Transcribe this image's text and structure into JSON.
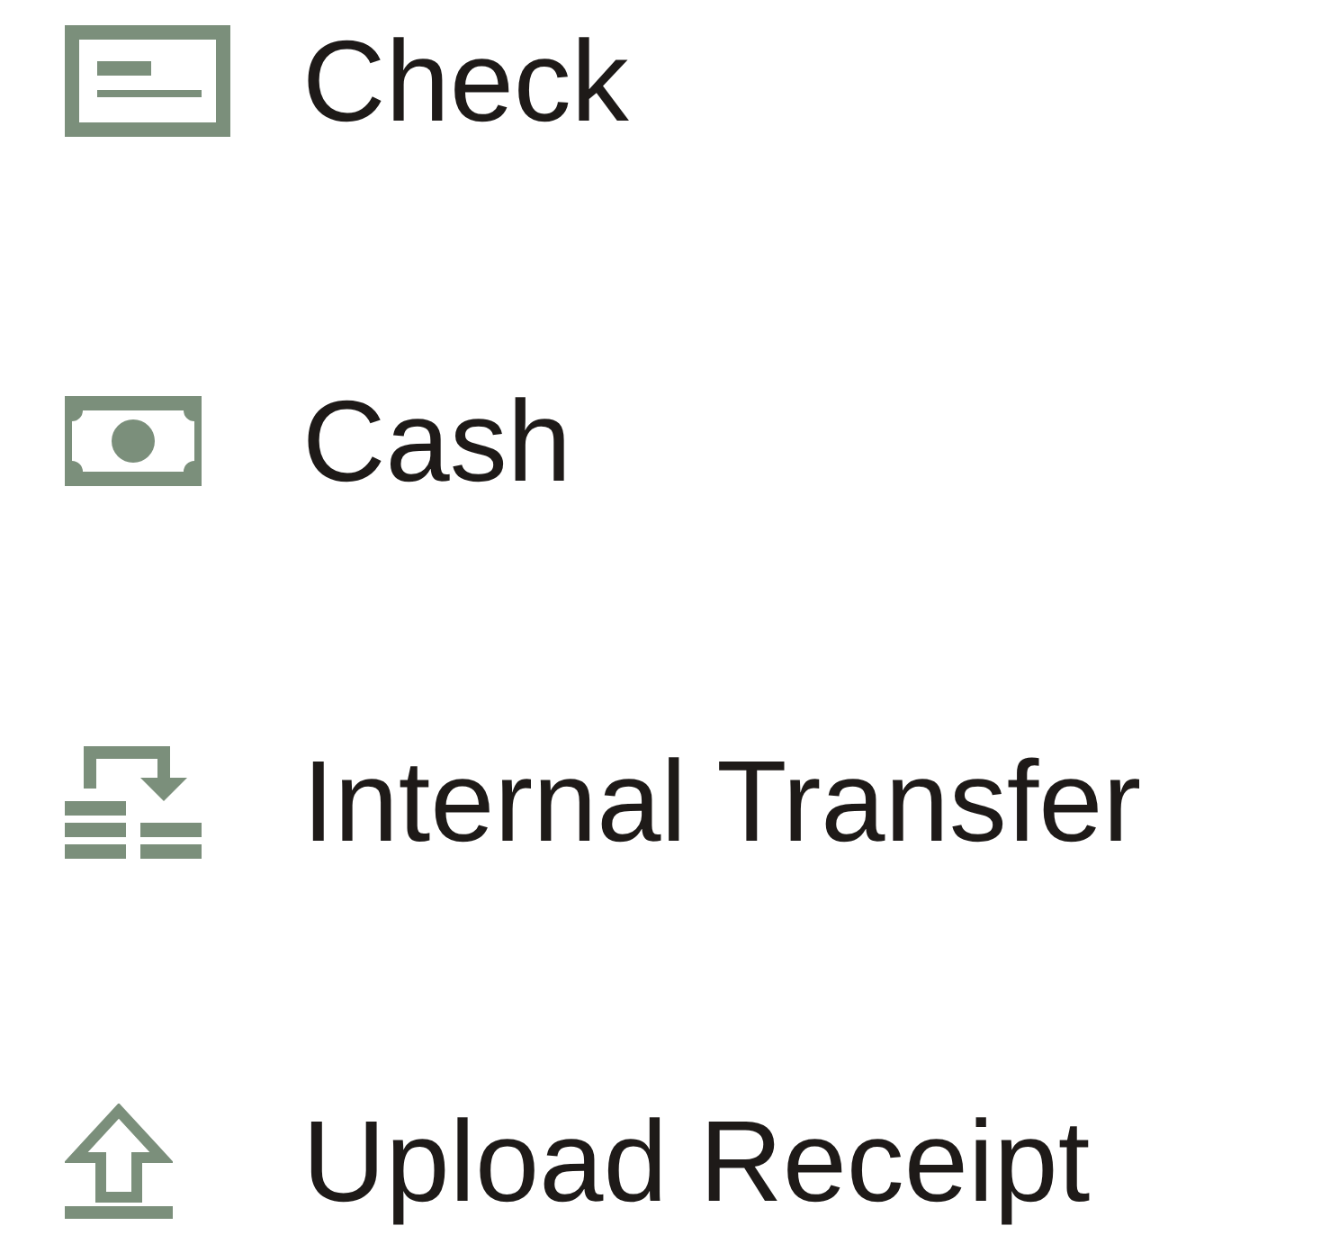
{
  "menu": {
    "items": [
      {
        "label": "Check"
      },
      {
        "label": "Cash"
      },
      {
        "label": "Internal Transfer"
      },
      {
        "label": "Upload Receipt"
      }
    ]
  }
}
